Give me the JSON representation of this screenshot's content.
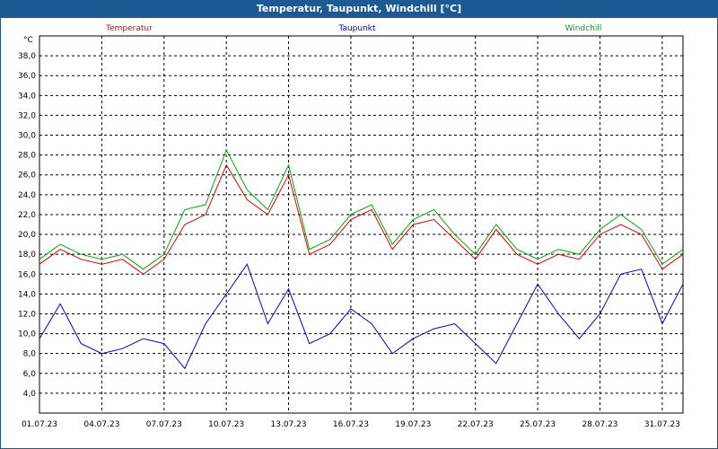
{
  "window": {
    "title": "Temperatur, Taupunkt, Windchill [°C]"
  },
  "chart_data": {
    "type": "line",
    "unit_label": "°C",
    "ylim": [
      2.0,
      40.0
    ],
    "yticks": [
      "4,0",
      "6,0",
      "8,0",
      "10,0",
      "12,0",
      "14,0",
      "16,0",
      "18,0",
      "20,0",
      "22,0",
      "24,0",
      "26,0",
      "28,0",
      "30,0",
      "32,0",
      "34,0",
      "36,0",
      "38,0"
    ],
    "xlim": [
      "2023-07-01",
      "2023-08-01"
    ],
    "xticks": [
      "01.07.23",
      "04.07.23",
      "07.07.23",
      "10.07.23",
      "13.07.23",
      "16.07.23",
      "19.07.23",
      "22.07.23",
      "25.07.23",
      "28.07.23",
      "31.07.23"
    ],
    "grid": true,
    "legend_position": "top",
    "x": [
      "2023-07-01",
      "2023-07-02",
      "2023-07-03",
      "2023-07-04",
      "2023-07-05",
      "2023-07-06",
      "2023-07-07",
      "2023-07-08",
      "2023-07-09",
      "2023-07-10",
      "2023-07-11",
      "2023-07-12",
      "2023-07-13",
      "2023-07-14",
      "2023-07-15",
      "2023-07-16",
      "2023-07-17",
      "2023-07-18",
      "2023-07-19",
      "2023-07-20",
      "2023-07-21",
      "2023-07-22",
      "2023-07-23",
      "2023-07-24",
      "2023-07-25",
      "2023-07-26",
      "2023-07-27",
      "2023-07-28",
      "2023-07-29",
      "2023-07-30",
      "2023-07-31",
      "2023-08-01"
    ],
    "series": [
      {
        "name": "Temperatur",
        "color": "#e00000",
        "values": [
          17.0,
          18.5,
          17.5,
          17.0,
          17.5,
          16.0,
          17.5,
          21.0,
          22.0,
          27.0,
          23.5,
          22.0,
          26.0,
          18.0,
          19.0,
          21.5,
          22.5,
          18.5,
          21.0,
          21.5,
          19.5,
          17.5,
          20.5,
          18.0,
          17.0,
          18.0,
          17.5,
          20.0,
          21.0,
          20.0,
          16.5,
          18.0
        ]
      },
      {
        "name": "Taupunkt",
        "color": "#0000cc",
        "values": [
          9.5,
          13.0,
          9.0,
          8.0,
          8.5,
          9.5,
          9.0,
          6.5,
          11.0,
          14.0,
          17.0,
          11.0,
          14.5,
          9.0,
          10.0,
          12.5,
          11.0,
          8.0,
          9.5,
          10.5,
          11.0,
          9.0,
          7.0,
          11.0,
          15.0,
          12.0,
          9.5,
          12.0,
          16.0,
          16.5,
          11.0,
          15.0
        ]
      },
      {
        "name": "Windchill",
        "color": "#00aa00",
        "values": [
          17.5,
          19.0,
          18.0,
          17.5,
          18.0,
          16.5,
          18.0,
          22.5,
          23.0,
          28.5,
          24.5,
          22.5,
          27.0,
          18.5,
          19.5,
          22.0,
          23.0,
          19.0,
          21.5,
          22.5,
          20.0,
          18.0,
          21.0,
          18.5,
          17.5,
          18.5,
          18.0,
          20.5,
          22.0,
          20.5,
          17.0,
          18.5
        ]
      }
    ]
  }
}
